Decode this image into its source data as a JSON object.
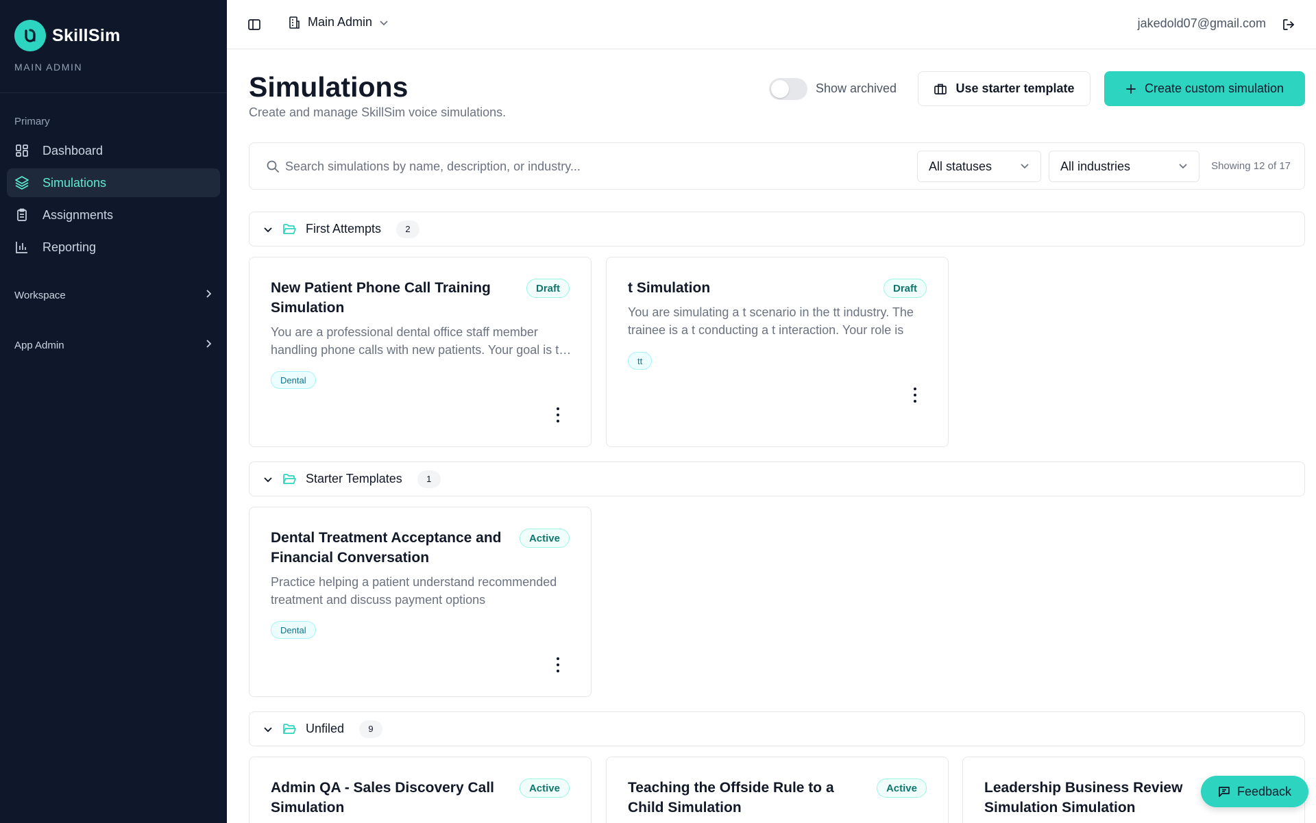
{
  "brand": {
    "name": "SkillSim",
    "subtitle": "MAIN ADMIN"
  },
  "sidebar": {
    "primary_label": "Primary",
    "items": [
      {
        "label": "Dashboard",
        "icon": "grid-icon"
      },
      {
        "label": "Simulations",
        "icon": "layers-icon",
        "active": true
      },
      {
        "label": "Assignments",
        "icon": "clipboard-icon"
      },
      {
        "label": "Reporting",
        "icon": "bar-chart-icon"
      }
    ],
    "groups": [
      {
        "label": "Workspace"
      },
      {
        "label": "App Admin"
      }
    ]
  },
  "topbar": {
    "org_name": "Main Admin",
    "user_email": "jakedold07@gmail.com"
  },
  "header": {
    "title": "Simulations",
    "subtitle": "Create and manage SkillSim voice simulations.",
    "show_archived_label": "Show archived",
    "show_archived_on": false,
    "starter_button": "Use starter template",
    "create_button": "Create custom simulation"
  },
  "filters": {
    "search_placeholder": "Search simulations by name, description, or industry...",
    "status_value": "All statuses",
    "industry_value": "All industries",
    "showing": "Showing 12 of 17"
  },
  "folders": [
    {
      "name": "First Attempts",
      "count": "2",
      "cards": [
        {
          "title": "New Patient Phone Call Training Simulation",
          "status": "Draft",
          "description": "You are a professional dental office staff member handling phone calls with new patients. Your goal is to help",
          "tag": "Dental"
        },
        {
          "title": "t Simulation",
          "status": "Draft",
          "description": "You are simulating a t scenario in the tt industry. The trainee is a t conducting a t interaction. Your role is",
          "tag": "tt"
        }
      ]
    },
    {
      "name": "Starter Templates",
      "count": "1",
      "cards": [
        {
          "title": "Dental Treatment Acceptance and Financial Conversation",
          "status": "Active",
          "description": "Practice helping a patient understand recommended treatment and discuss payment options",
          "tag": "Dental"
        }
      ]
    },
    {
      "name": "Unfiled",
      "count": "9",
      "cards": [
        {
          "title": "Admin QA - Sales Discovery Call Simulation",
          "status": "Active"
        },
        {
          "title": "Teaching the Offside Rule to a Child Simulation",
          "status": "Active"
        },
        {
          "title": "Leadership Business Review Simulation Simulation"
        }
      ]
    }
  ],
  "feedback_label": "Feedback",
  "colors": {
    "accent": "#2dd4bf",
    "sidebar_bg": "#0f172a",
    "active_text": "#5eead4"
  }
}
